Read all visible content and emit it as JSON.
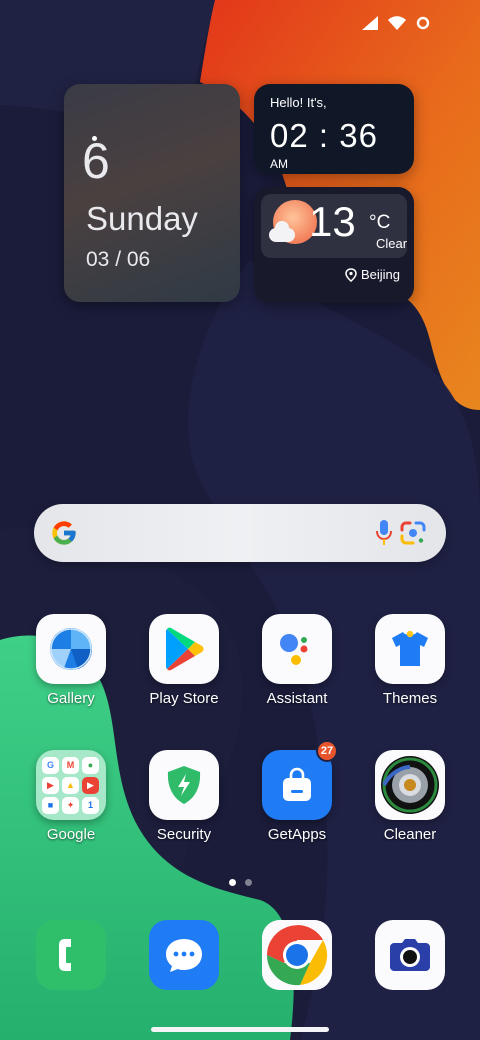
{
  "status_bar": {
    "icons": [
      "signal-icon",
      "wifi-icon",
      "circle-indicator-icon"
    ]
  },
  "date_widget": {
    "day_number": "6",
    "weekday": "Sunday",
    "date": "03 / 06"
  },
  "clock_widget": {
    "greeting": "Hello! It's,",
    "time": "02 : 36",
    "ampm": "AM"
  },
  "weather_widget": {
    "temperature": "13",
    "unit": "°C",
    "condition": "Clear",
    "location": "Beijing"
  },
  "search_bar": {
    "icons": [
      "google-g-icon",
      "mic-icon",
      "lens-icon"
    ]
  },
  "apps_row1": [
    {
      "label": "Gallery",
      "icon": "gallery-icon"
    },
    {
      "label": "Play Store",
      "icon": "play-store-icon"
    },
    {
      "label": "Assistant",
      "icon": "assistant-icon"
    },
    {
      "label": "Themes",
      "icon": "themes-icon"
    }
  ],
  "apps_row2": [
    {
      "label": "Google",
      "icon": "google-folder-icon"
    },
    {
      "label": "Security",
      "icon": "security-icon"
    },
    {
      "label": "GetApps",
      "icon": "getapps-icon",
      "badge": "27"
    },
    {
      "label": "Cleaner",
      "icon": "cleaner-icon"
    }
  ],
  "page_indicator": {
    "pages": 2,
    "active": 1
  },
  "dock": [
    {
      "icon": "phone-icon"
    },
    {
      "icon": "messages-icon"
    },
    {
      "icon": "chrome-icon"
    },
    {
      "icon": "camera-icon"
    }
  ],
  "colors": {
    "wallpaper_dark": "#151733",
    "wallpaper_orange": "#e8561e",
    "wallpaper_green": "#35c57a",
    "badge": "#e8552d",
    "accent_blue": "#1f7cf5"
  }
}
